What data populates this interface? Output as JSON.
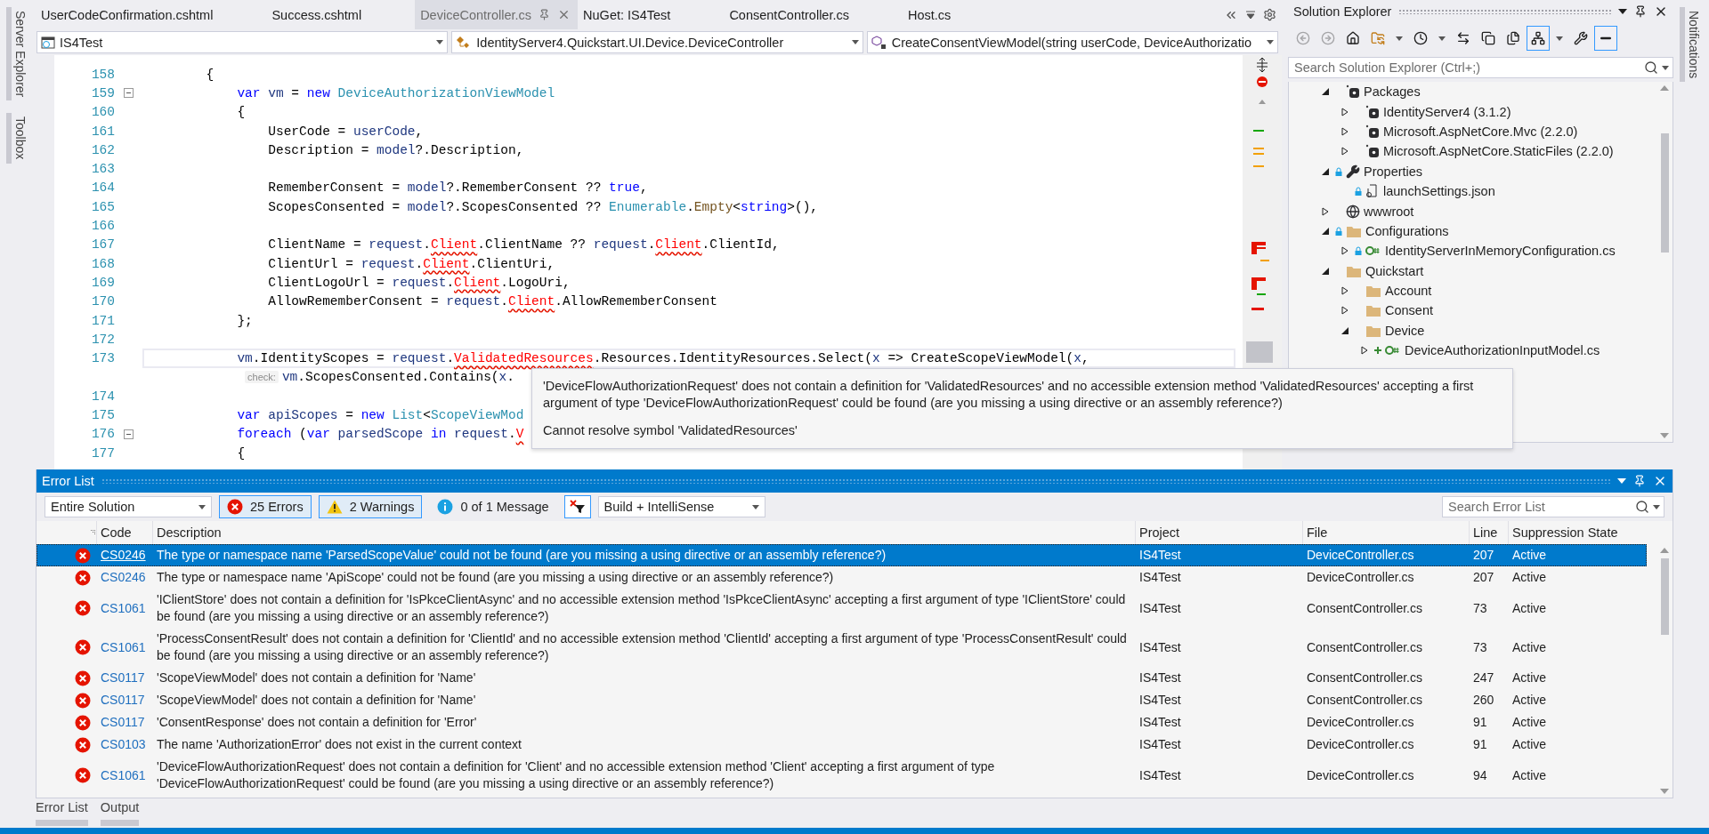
{
  "left_sidebar": {
    "tabs": [
      {
        "label": "Server Explorer"
      },
      {
        "label": "Toolbox"
      }
    ]
  },
  "right_sidebar": {
    "tabs": [
      {
        "label": "Notifications"
      }
    ]
  },
  "editor": {
    "tabs": [
      {
        "label": "UserCodeConfirmation.cshtml",
        "selected": false
      },
      {
        "label": "Success.cshtml",
        "selected": false
      },
      {
        "label": "DeviceController.cs",
        "selected": true
      },
      {
        "label": "NuGet: IS4Test",
        "selected": false
      },
      {
        "label": "ConsentController.cs",
        "selected": false
      },
      {
        "label": "Host.cs",
        "selected": false
      }
    ],
    "navigation": [
      {
        "kind": "project",
        "label": "IS4Test"
      },
      {
        "kind": "class",
        "label": "IdentityServer4.Quickstart.UI.Device.DeviceController"
      },
      {
        "kind": "method",
        "label": "CreateConsentViewModel(string userCode, DeviceAuthorizatio"
      }
    ],
    "lines": [
      {
        "number": "158",
        "fold": false,
        "current": false,
        "segments": [
          {
            "kind": "plain",
            "text": "        {"
          }
        ]
      },
      {
        "number": "159",
        "fold": true,
        "current": false,
        "segments": [
          {
            "kind": "keyword",
            "text": "            var"
          },
          {
            "kind": "variable",
            "text": " vm"
          },
          {
            "kind": "plain",
            "text": " = "
          },
          {
            "kind": "keyword",
            "text": "new"
          },
          {
            "kind": "type",
            "text": " DeviceAuthorizationViewModel"
          }
        ]
      },
      {
        "number": "160",
        "fold": false,
        "current": false,
        "segments": [
          {
            "kind": "plain",
            "text": "            {"
          }
        ]
      },
      {
        "number": "161",
        "fold": false,
        "current": false,
        "segments": [
          {
            "kind": "plain",
            "text": "                UserCode = "
          },
          {
            "kind": "variable",
            "text": "userCode"
          },
          {
            "kind": "plain",
            "text": ","
          }
        ]
      },
      {
        "number": "162",
        "fold": false,
        "current": false,
        "segments": [
          {
            "kind": "plain",
            "text": "                Description = "
          },
          {
            "kind": "variable",
            "text": "model"
          },
          {
            "kind": "plain",
            "text": "?.Description,"
          }
        ]
      },
      {
        "number": "163",
        "fold": false,
        "current": false
      },
      {
        "number": "164",
        "fold": false,
        "current": false,
        "segments": [
          {
            "kind": "plain",
            "text": "                RememberConsent = "
          },
          {
            "kind": "variable",
            "text": "model"
          },
          {
            "kind": "plain",
            "text": "?.RememberConsent ?? "
          },
          {
            "kind": "keyword",
            "text": "true"
          },
          {
            "kind": "plain",
            "text": ","
          }
        ]
      },
      {
        "number": "165",
        "fold": false,
        "current": false,
        "segments": [
          {
            "kind": "plain",
            "text": "                ScopesConsented = "
          },
          {
            "kind": "variable",
            "text": "model"
          },
          {
            "kind": "plain",
            "text": "?.ScopesConsented ?? "
          },
          {
            "kind": "type",
            "text": "Enumerable"
          },
          {
            "kind": "plain",
            "text": "."
          },
          {
            "kind": "method",
            "text": "Empty"
          },
          {
            "kind": "plain",
            "text": "<"
          },
          {
            "kind": "keyword",
            "text": "string"
          },
          {
            "kind": "plain",
            "text": ">(),"
          }
        ]
      },
      {
        "number": "166",
        "fold": false,
        "current": false
      },
      {
        "number": "167",
        "fold": false,
        "current": false,
        "segments": [
          {
            "kind": "plain",
            "text": "                ClientName = "
          },
          {
            "kind": "variable",
            "text": "request"
          },
          {
            "kind": "plain",
            "text": "."
          },
          {
            "kind": "error",
            "text": "Client"
          },
          {
            "kind": "plain",
            "text": ".ClientName ?? "
          },
          {
            "kind": "variable",
            "text": "request"
          },
          {
            "kind": "plain",
            "text": "."
          },
          {
            "kind": "error",
            "text": "Client"
          },
          {
            "kind": "plain",
            "text": ".ClientId,"
          }
        ]
      },
      {
        "number": "168",
        "fold": false,
        "current": false,
        "segments": [
          {
            "kind": "plain",
            "text": "                ClientUrl = "
          },
          {
            "kind": "variable",
            "text": "request"
          },
          {
            "kind": "plain",
            "text": "."
          },
          {
            "kind": "error",
            "text": "Client"
          },
          {
            "kind": "plain",
            "text": ".ClientUri,"
          }
        ]
      },
      {
        "number": "169",
        "fold": false,
        "current": false,
        "segments": [
          {
            "kind": "plain",
            "text": "                ClientLogoUrl = "
          },
          {
            "kind": "variable",
            "text": "request"
          },
          {
            "kind": "plain",
            "text": "."
          },
          {
            "kind": "error",
            "text": "Client"
          },
          {
            "kind": "plain",
            "text": ".LogoUri,"
          }
        ]
      },
      {
        "number": "170",
        "fold": false,
        "current": false,
        "segments": [
          {
            "kind": "plain",
            "text": "                AllowRememberConsent = "
          },
          {
            "kind": "variable",
            "text": "request"
          },
          {
            "kind": "plain",
            "text": "."
          },
          {
            "kind": "error",
            "text": "Client"
          },
          {
            "kind": "plain",
            "text": ".AllowRememberConsent"
          }
        ]
      },
      {
        "number": "171",
        "fold": false,
        "current": false,
        "segments": [
          {
            "kind": "plain",
            "text": "            };"
          }
        ]
      },
      {
        "number": "172",
        "fold": false,
        "current": false
      },
      {
        "number": "173",
        "fold": false,
        "current": true,
        "segments": [
          {
            "kind": "variable",
            "text": "            vm"
          },
          {
            "kind": "plain",
            "text": ".IdentityScopes = "
          },
          {
            "kind": "variable",
            "text": "request"
          },
          {
            "kind": "plain",
            "text": "."
          },
          {
            "kind": "error",
            "text": "ValidatedResources"
          },
          {
            "kind": "plain",
            "text": ".Resources.IdentityResources.Select("
          },
          {
            "kind": "variable",
            "text": "x"
          },
          {
            "kind": "plain",
            "text": " => CreateScopeViewModel("
          },
          {
            "kind": "variable",
            "text": "x"
          },
          {
            "kind": "plain",
            "text": ","
          }
        ]
      },
      {
        "fold": false,
        "current": false,
        "segments": [
          {
            "kind": "hint",
            "text": "check:"
          },
          {
            "kind": "variable",
            "text": "vm"
          },
          {
            "kind": "plain",
            "text": ".ScopesConsented.Contains("
          },
          {
            "kind": "variable",
            "text": "x"
          },
          {
            "kind": "plain",
            "text": "."
          }
        ]
      },
      {
        "number": "174",
        "fold": false,
        "current": false
      },
      {
        "number": "175",
        "fold": false,
        "current": false,
        "segments": [
          {
            "kind": "keyword",
            "text": "            var"
          },
          {
            "kind": "variable",
            "text": " apiScopes"
          },
          {
            "kind": "plain",
            "text": " = "
          },
          {
            "kind": "keyword",
            "text": "new"
          },
          {
            "kind": "type",
            "text": " List"
          },
          {
            "kind": "plain",
            "text": "<"
          },
          {
            "kind": "type",
            "text": "ScopeViewMod"
          }
        ]
      },
      {
        "number": "176",
        "fold": true,
        "current": false,
        "segments": [
          {
            "kind": "keyword",
            "text": "            foreach"
          },
          {
            "kind": "plain",
            "text": " ("
          },
          {
            "kind": "keyword",
            "text": "var"
          },
          {
            "kind": "variable",
            "text": " parsedScope"
          },
          {
            "kind": "keyword",
            "text": " in"
          },
          {
            "kind": "variable",
            "text": " request"
          },
          {
            "kind": "plain",
            "text": "."
          },
          {
            "kind": "error",
            "text": "V"
          }
        ]
      },
      {
        "number": "177",
        "fold": false,
        "current": false,
        "segments": [
          {
            "kind": "plain",
            "text": "            {"
          }
        ]
      }
    ],
    "tooltip": {
      "messages": [
        "'DeviceFlowAuthorizationRequest' does not contain a definition for 'ValidatedResources' and no accessible extension method 'ValidatedResources' accepting a first argument of type 'DeviceFlowAuthorizationRequest' could be found (are you missing a using directive or an assembly reference?)",
        "Cannot resolve symbol 'ValidatedResources'"
      ]
    }
  },
  "solution_explorer": {
    "title": "Solution Explorer",
    "toolbar": [
      {
        "kind": "back",
        "disabled": true,
        "selected": false
      },
      {
        "kind": "forward",
        "disabled": true,
        "selected": false
      },
      {
        "kind": "home",
        "disabled": false,
        "selected": false
      },
      {
        "kind": "sync",
        "disabled": false,
        "selected": false
      },
      {
        "kind": "caret",
        "disabled": false,
        "selected": false
      },
      {
        "kind": "history",
        "disabled": false,
        "selected": false
      },
      {
        "kind": "caret",
        "disabled": false,
        "selected": false
      },
      {
        "kind": "swap",
        "disabled": false,
        "selected": false
      },
      {
        "kind": "collapse",
        "disabled": false,
        "selected": false
      },
      {
        "kind": "files",
        "disabled": false,
        "selected": false
      },
      {
        "kind": "show_all",
        "disabled": false,
        "selected": true
      },
      {
        "kind": "caret",
        "disabled": false,
        "selected": false
      },
      {
        "kind": "wrench",
        "disabled": false,
        "selected": false
      },
      {
        "kind": "preview",
        "disabled": false,
        "selected": true
      }
    ],
    "search": {
      "placeholder": "Search Solution Explorer (Ctrl+;)"
    },
    "tree": [
      {
        "label": "Packages",
        "kind": "package",
        "expanded": true,
        "children": [
          {
            "label": "IdentityServer4 (3.1.2)",
            "kind": "package",
            "expanded": false
          },
          {
            "label": "Microsoft.AspNetCore.Mvc (2.2.0)",
            "kind": "package",
            "expanded": false
          },
          {
            "label": "Microsoft.AspNetCore.StaticFiles (2.2.0)",
            "kind": "package",
            "expanded": false
          }
        ]
      },
      {
        "label": "Properties",
        "kind": "wrench",
        "expanded": true,
        "locked": true,
        "children": [
          {
            "label": "launchSettings.json",
            "kind": "json",
            "locked": true
          }
        ]
      },
      {
        "label": "wwwroot",
        "kind": "globe",
        "expanded": false
      },
      {
        "label": "Configurations",
        "kind": "folder",
        "expanded": true,
        "locked": true,
        "children": [
          {
            "label": "IdentityServerInMemoryConfiguration.cs",
            "kind": "csharp",
            "expanded": false,
            "locked": true
          }
        ]
      },
      {
        "label": "Quickstart",
        "kind": "folder",
        "expanded": true,
        "children": [
          {
            "label": "Account",
            "kind": "folder",
            "expanded": false
          },
          {
            "label": "Consent",
            "kind": "folder",
            "expanded": false
          },
          {
            "label": "Device",
            "kind": "folder",
            "expanded": true,
            "children": [
              {
                "label": "DeviceAuthorizationInputModel.cs",
                "kind": "csharp",
                "expanded": false,
                "added": true
              }
            ]
          }
        ]
      }
    ]
  },
  "error_list": {
    "title": "Error List",
    "scope": {
      "label": "Entire Solution"
    },
    "filters": [
      {
        "kind": "error",
        "label": "25 Errors",
        "selected": true
      },
      {
        "kind": "warning",
        "label": "2 Warnings",
        "selected": true
      },
      {
        "kind": "message",
        "label": "0 of 1 Message",
        "selected": false
      }
    ],
    "source": {
      "label": "Build + IntelliSense"
    },
    "search": {
      "placeholder": "Search Error List"
    },
    "columns": [
      "Code",
      "Description",
      "Project",
      "File",
      "Line",
      "Suppression State"
    ],
    "rows": [
      {
        "kind": "error",
        "selected": true,
        "code": "CS0246",
        "description": "The type or namespace name 'ParsedScopeValue' could not be found (are you missing a using directive or an assembly reference?)",
        "project": "IS4Test",
        "file": "DeviceController.cs",
        "line": "207",
        "suppression": "Active"
      },
      {
        "kind": "error",
        "selected": false,
        "code": "CS0246",
        "description": "The type or namespace name 'ApiScope' could not be found (are you missing a using directive or an assembly reference?)",
        "project": "IS4Test",
        "file": "DeviceController.cs",
        "line": "207",
        "suppression": "Active"
      },
      {
        "kind": "error",
        "selected": false,
        "code": "CS1061",
        "description": "'IClientStore' does not contain a definition for 'IsPkceClientAsync' and no accessible extension method 'IsPkceClientAsync' accepting a first argument of type 'IClientStore' could be found (are you missing a using directive or an assembly reference?)",
        "project": "IS4Test",
        "file": "ConsentController.cs",
        "line": "73",
        "suppression": "Active"
      },
      {
        "kind": "error",
        "selected": false,
        "code": "CS1061",
        "description": "'ProcessConsentResult' does not contain a definition for 'ClientId' and no accessible extension method 'ClientId' accepting a first argument of type 'ProcessConsentResult' could be found (are you missing a using directive or an assembly reference?)",
        "project": "IS4Test",
        "file": "ConsentController.cs",
        "line": "73",
        "suppression": "Active"
      },
      {
        "kind": "error",
        "selected": false,
        "code": "CS0117",
        "description": "'ScopeViewModel' does not contain a definition for 'Name'",
        "project": "IS4Test",
        "file": "ConsentController.cs",
        "line": "247",
        "suppression": "Active"
      },
      {
        "kind": "error",
        "selected": false,
        "code": "CS0117",
        "description": "'ScopeViewModel' does not contain a definition for 'Name'",
        "project": "IS4Test",
        "file": "ConsentController.cs",
        "line": "260",
        "suppression": "Active"
      },
      {
        "kind": "error",
        "selected": false,
        "code": "CS0117",
        "description": "'ConsentResponse' does not contain a definition for 'Error'",
        "project": "IS4Test",
        "file": "DeviceController.cs",
        "line": "91",
        "suppression": "Active"
      },
      {
        "kind": "error",
        "selected": false,
        "code": "CS0103",
        "description": "The name 'AuthorizationError' does not exist in the current context",
        "project": "IS4Test",
        "file": "DeviceController.cs",
        "line": "91",
        "suppression": "Active"
      },
      {
        "kind": "error",
        "selected": false,
        "code": "CS1061",
        "description": "'DeviceFlowAuthorizationRequest' does not contain a definition for 'Client' and no accessible extension method 'Client' accepting a first argument of type 'DeviceFlowAuthorizationRequest' could be found (are you missing a using directive or an assembly reference?)",
        "project": "IS4Test",
        "file": "DeviceController.cs",
        "line": "94",
        "suppression": "Active"
      }
    ]
  },
  "bottom_tabs": [
    {
      "label": "Error List"
    },
    {
      "label": "Output"
    }
  ]
}
